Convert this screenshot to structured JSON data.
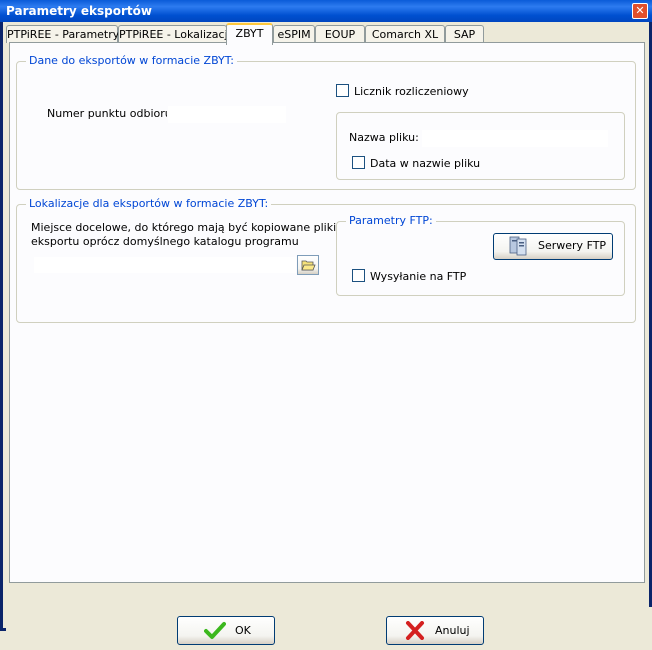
{
  "window": {
    "title": "Parametry eksportów",
    "close_glyph": "✕"
  },
  "tabs": [
    {
      "label": "PTPiREE - Parametry"
    },
    {
      "label": "PTPiREE - Lokalizacja"
    },
    {
      "label": "ZBYT",
      "active": true
    },
    {
      "label": "eSPIM"
    },
    {
      "label": "EOUP"
    },
    {
      "label": "Comarch XL"
    },
    {
      "label": "SAP"
    }
  ],
  "dane_group": {
    "title": "Dane do eksportów w formacie ZBYT:",
    "numer_label": "Numer punktu odbioru:",
    "numer_value": "",
    "licznik_label": "Licznik rozliczeniowy",
    "licznik_checked": false,
    "nazwa_pliku_label": "Nazwa pliku:",
    "nazwa_pliku_value": "",
    "data_label": "Data w nazwie pliku",
    "data_checked": false
  },
  "lokalizacje_group": {
    "title": "Lokalizacje dla eksportów w formacie ZBYT:",
    "desc_line1": "Miejsce docelowe, do którego mają być kopiowane pliki",
    "desc_line2": "eksportu oprócz domyślnego katalogu programu",
    "path_value": "",
    "browse_icon": "folder-open-icon",
    "ftp_title": "Parametry FTP:",
    "serwery_label": "Serwery FTP",
    "wysylanie_label": "Wysyłanie na FTP",
    "wysylanie_checked": false
  },
  "footer": {
    "ok_label": "OK",
    "cancel_label": "Anuluj"
  },
  "colors": {
    "group_title": "#0046d5",
    "ok_check": "#3cb81e",
    "cancel_x": "#d42020"
  }
}
